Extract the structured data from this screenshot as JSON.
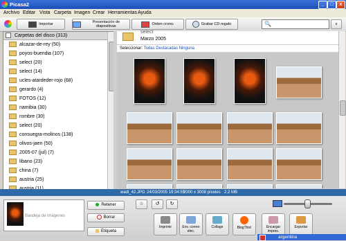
{
  "window": {
    "title": "Picasa2",
    "min": "_",
    "max": "□",
    "close": "x"
  },
  "menu": [
    "Archivo",
    "Editar",
    "Vista",
    "Carpeta",
    "Imagen",
    "Crear",
    "Herramientas",
    "Ayuda"
  ],
  "toolbar": {
    "import": "Importar",
    "slideshow": "Presentación de diapositivas",
    "timeline": "Orden crono.",
    "burn_cd": "Grabar CD regalo",
    "search_value": "",
    "search_clear": "x"
  },
  "folders": {
    "header": "Carpetas del disco (313)",
    "items": [
      "alcazar-de-rey (50)",
      "poyos-buendia (107)",
      "select (20)",
      "select (14)",
      "ucles-atardeder-rojo (68)",
      "gerardo (4)",
      "FOTOS (12)",
      "namibia (30)",
      "rombre (30)",
      "select (20)",
      "consuegra-molinos (138)",
      "olivos-jaen (50)",
      "2005-07 (jul) (7)",
      "libano (23)",
      "china (7)",
      "austria (25)",
      "austria (11)"
    ]
  },
  "main": {
    "folder_title": "select",
    "date": "Marzo 2005",
    "select_label": "Seleccionar:",
    "select_all": "Todas",
    "select_starred": "Destacadas",
    "select_none": "Ninguna"
  },
  "thumbnails": [
    "dark",
    "dark",
    "dark",
    "desert",
    "desert",
    "desert",
    "desert",
    "desert",
    "desert",
    "desert",
    "desert",
    "desert",
    "desert",
    "desert",
    "desert",
    "desert"
  ],
  "status": {
    "filename": "wadi_42.JPG",
    "datetime": "24/03/2005 19:34:55",
    "dimensions": "2000 x 3008 píxeles",
    "size": "2.2 MB"
  },
  "tray": {
    "label": "Bandeja de imágenes",
    "hold": "Retener",
    "clear": "Borrar",
    "label_btn": "Etiqueta"
  },
  "actions": {
    "print": "Imprimir",
    "email": "Env. correo elec.",
    "collage": "Collage",
    "blog": "BlogThis!",
    "order": "Encargar impres.",
    "export": "Exportar"
  },
  "taskbar": {
    "item": "argentina"
  }
}
